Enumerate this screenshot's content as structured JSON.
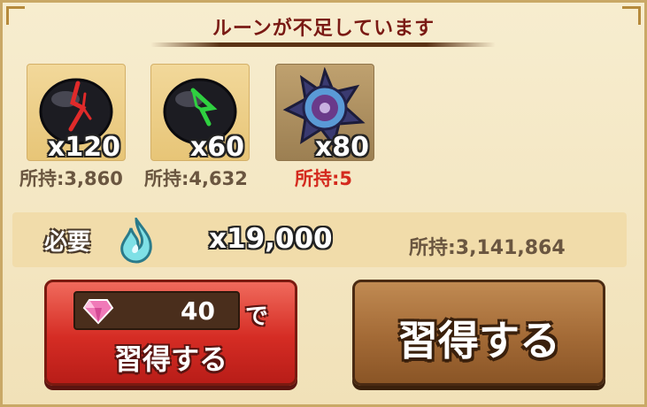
{
  "dialog": {
    "title": "ルーンが不足しています",
    "items": [
      {
        "icon": "red-rune-stone-icon",
        "quantity": "x120",
        "owned": "所持:3,860",
        "sufficient": true
      },
      {
        "icon": "green-rune-stone-icon",
        "quantity": "x60",
        "owned": "所持:4,632",
        "sufficient": true
      },
      {
        "icon": "purple-medal-icon",
        "quantity": "x80",
        "owned": "所持:5",
        "sufficient": false
      }
    ],
    "required": {
      "label": "必要",
      "icon": "blue-flame-icon",
      "quantity": "x19,000",
      "owned": "所持:3,141,864"
    },
    "gem_button": {
      "icon": "diamond-icon",
      "gem_count": "40",
      "suffix": "で",
      "label": "習得する"
    },
    "learn_button": {
      "label": "習得する"
    }
  },
  "colors": {
    "title": "#7a1a14",
    "insufficient": "#d42a1e",
    "gem_button": "#d52c24",
    "learn_button": "#a36a36"
  }
}
